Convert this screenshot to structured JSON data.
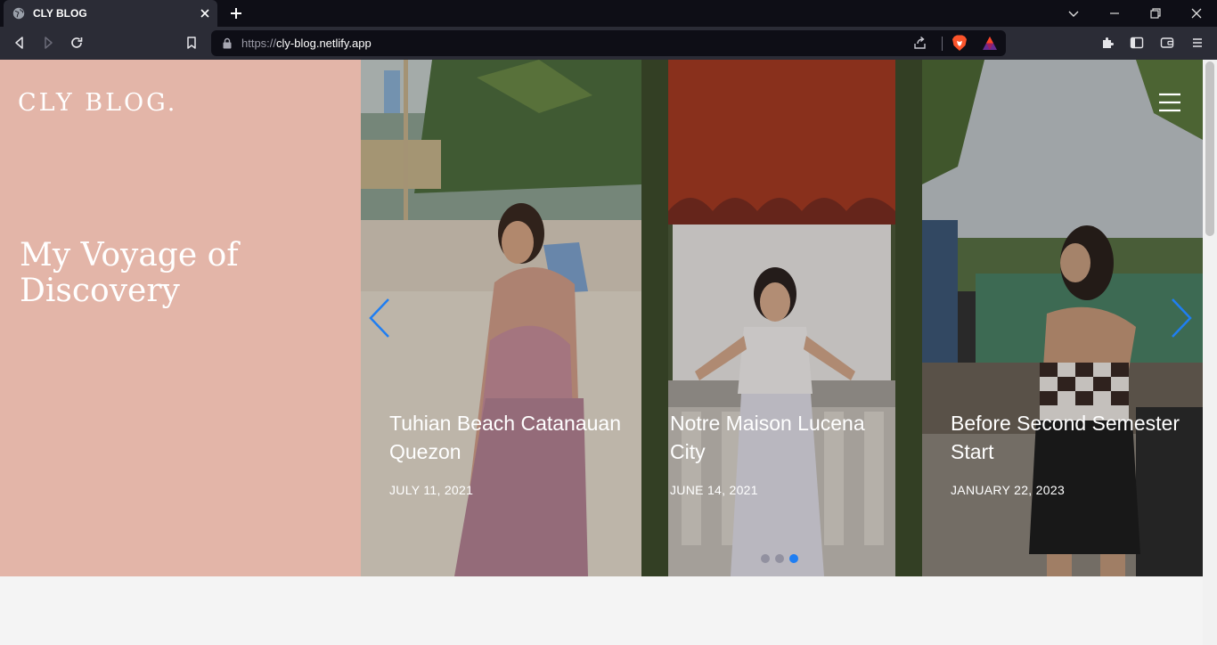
{
  "browser": {
    "tab_title": "CLY BLOG",
    "url_scheme": "https://",
    "url_host": "cly-blog.netlify.app",
    "icons": [
      "globe-icon",
      "close-icon",
      "plus-icon",
      "chevron-down-icon",
      "minimize-icon",
      "restore-icon",
      "close-window-icon",
      "back-icon",
      "forward-icon",
      "reload-icon",
      "bookmark-icon",
      "lock-icon",
      "share-icon",
      "brave-shield-icon",
      "bat-icon",
      "extensions-icon",
      "sidebar-icon",
      "wallet-icon",
      "menu-icon"
    ]
  },
  "hero": {
    "brand": "CLY BLOG.",
    "headline": "My Voyage of Discovery",
    "background": "#e3b5a8"
  },
  "carousel": {
    "slides": [
      {
        "title": "Tuhian Beach Catanauan Quezon",
        "date": "JULY 11, 2021"
      },
      {
        "title": "Notre Maison Lucena City",
        "date": "JUNE 14, 2021"
      },
      {
        "title": "Before Second Semester Start",
        "date": "JANUARY 22, 2023"
      }
    ],
    "dots_total": 3,
    "active_dot": 3,
    "accent": "#1f7ef2"
  }
}
